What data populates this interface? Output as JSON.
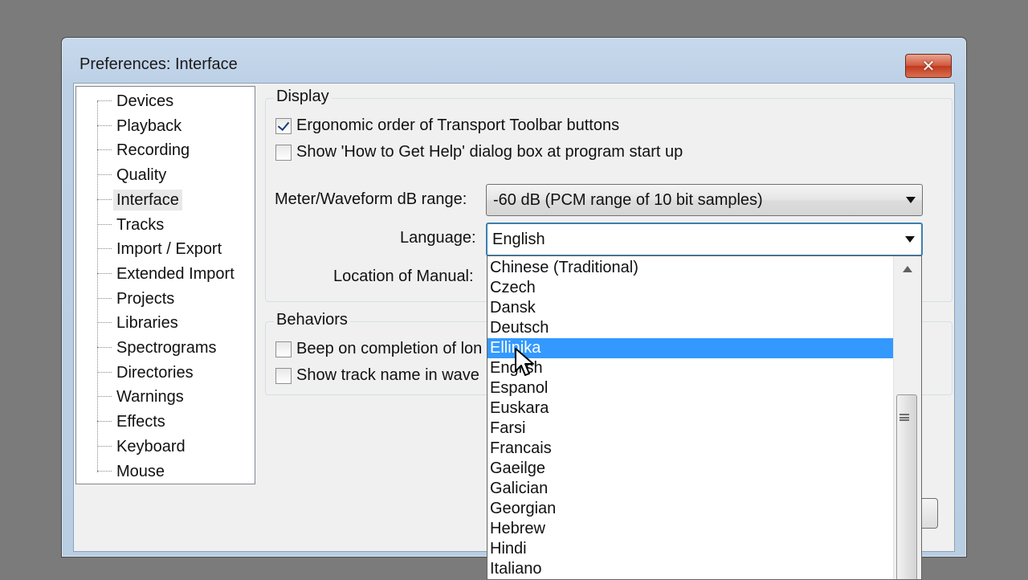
{
  "window": {
    "title": "Preferences: Interface",
    "close_glyph": "✕"
  },
  "tree": {
    "items": [
      "Devices",
      "Playback",
      "Recording",
      "Quality",
      "Interface",
      "Tracks",
      "Import / Export",
      "Extended Import",
      "Projects",
      "Libraries",
      "Spectrograms",
      "Directories",
      "Warnings",
      "Effects",
      "Keyboard",
      "Mouse"
    ],
    "selected": "Interface"
  },
  "display": {
    "title": "Display",
    "ergonomic_label": "Ergonomic order of Transport Toolbar buttons",
    "ergonomic_checked": true,
    "help_label": "Show 'How to Get Help' dialog box at program start up",
    "help_checked": false,
    "meter_label": "Meter/Waveform dB range:",
    "meter_value": "-60 dB (PCM range of 10 bit samples)",
    "language_label": "Language:",
    "language_value": "English",
    "manual_label": "Location of Manual:"
  },
  "behaviors": {
    "title": "Behaviors",
    "beep_label": "Beep on completion of lon",
    "trackname_label": "Show track name in wave"
  },
  "language_dropdown": {
    "items": [
      "Chinese (Traditional)",
      "Czech",
      "Dansk",
      "Deutsch",
      "Ellinika",
      "English",
      "Espanol",
      "Euskara",
      "Farsi",
      "Francais",
      "Gaeilge",
      "Galician",
      "Georgian",
      "Hebrew",
      "Hindi",
      "Italiano"
    ],
    "highlighted": "Ellinika"
  },
  "colors": {
    "highlight": "#3399ff",
    "close_button": "#c7442a",
    "frame": "#bcd0e6"
  },
  "icons": [
    "close-icon",
    "dropdown-arrow-icon",
    "scroll-up-icon",
    "scroll-grip-icon",
    "mouse-cursor-icon",
    "checkmark-icon"
  ]
}
